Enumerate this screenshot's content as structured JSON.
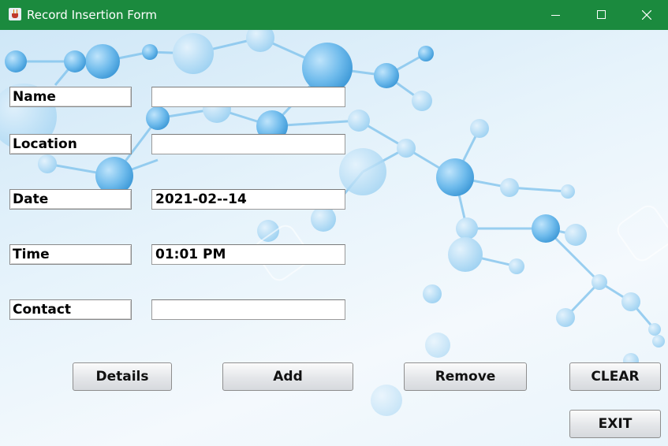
{
  "window": {
    "title": "Record Insertion Form"
  },
  "form": {
    "fields": [
      {
        "label": "Name",
        "value": ""
      },
      {
        "label": "Location",
        "value": ""
      },
      {
        "label": "Date",
        "value": "2021-02--14"
      },
      {
        "label": "Time",
        "value": "01:01 PM"
      },
      {
        "label": "Contact",
        "value": ""
      }
    ]
  },
  "buttons": {
    "details": "Details",
    "add": "Add",
    "remove": "Remove",
    "clear": "CLEAR",
    "exit": "EXIT"
  },
  "colors": {
    "titlebar": "#1b8a3e",
    "background": "#e6f3fb",
    "molecule": "#5fb0e8"
  },
  "icons": {
    "app": "java-app-icon",
    "minimize": "minimize-icon",
    "maximize": "maximize-icon",
    "close": "close-icon"
  }
}
